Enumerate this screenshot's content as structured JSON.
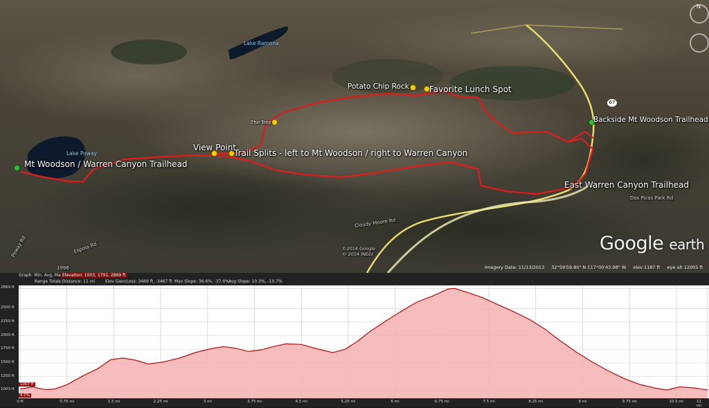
{
  "map": {
    "labels": {
      "trailhead_main": "Mt Woodson / Warren Canyon Trailhead",
      "view_point": "View Point",
      "trail_splits": "Trail Splits - left to Mt Woodson / right to Warren Canyon",
      "potato_chip_rock": "Potato Chip Rock",
      "lunch_spot": "Favorite Lunch Spot",
      "backside_trailhead": "Backside Mt Woodson Trailhead",
      "east_warren": "East Warren Canyon Trailhead",
      "the_tree": "The Tree",
      "lake_poway": "Lake Poway",
      "lake_ramona": "Lake Ramona",
      "highway": "67",
      "road_1": "Espola Rd",
      "road_2": "Dos Picos Park Rd",
      "road_3": "Cloudy Moore Rd",
      "road_4": "Poway Rd",
      "year": "1996"
    },
    "copyright_1": "©2014 Google",
    "copyright_2": "© 2014 INEGI",
    "logo_main": "Google",
    "logo_sub": "earth",
    "compass_letter": "N",
    "status": {
      "imagery_date": "Imagery Date: 11/13/2013",
      "coords": "32°59'59.80\" N  117°00'43.98\" W",
      "elev": "elev  1187 ft",
      "eye_alt": "eye alt  12005 ft"
    }
  },
  "graph": {
    "header_graph": "Graph:  Min, Avg, Max:",
    "header_elevation": "Elevation: 1003, 1791, 2869 ft",
    "header_range": "Range Totals:",
    "header_distance": "Distance: 11 mi",
    "header_gain": "Elev Gain/Loss: 3469 ft, -3467 ft",
    "header_maxslope": "Max Slope: 36.6%, -37.0%",
    "header_avgslope": "Avg Slope: 10.3%, -10.7%",
    "cursor_elev": "1007 ft",
    "cursor_slope": "4.1%"
  },
  "chart_data": {
    "type": "area",
    "title": "",
    "xlabel": "",
    "ylabel": "",
    "ylim": [
      850,
      2925
    ],
    "xlim": [
      0,
      11
    ],
    "y_ticks": [
      "2869 ft",
      "2500 ft",
      "2250 ft",
      "2000 ft",
      "1750 ft",
      "1500 ft",
      "1250 ft",
      "1003 ft"
    ],
    "y_tick_values": [
      2869,
      2500,
      2250,
      2000,
      1750,
      1500,
      1250,
      1003
    ],
    "x_ticks": [
      "0 ft",
      "0.75 mi",
      "1.5 mi",
      "2.25 mi",
      "3 mi",
      "3.75 mi",
      "4.5 mi",
      "5.25 mi",
      "6 mi",
      "6.75 mi",
      "7.5 mi",
      "8.25 mi",
      "9 mi",
      "9.75 mi",
      "10.5 mi",
      "11 mi"
    ],
    "x_tick_values": [
      0,
      0.75,
      1.5,
      2.25,
      3,
      3.75,
      4.5,
      5.25,
      6,
      6.75,
      7.5,
      8.25,
      9,
      9.75,
      10.5,
      11
    ],
    "series": [
      {
        "x": [
          0,
          0.2,
          0.4,
          0.55,
          0.75,
          1.0,
          1.25,
          1.45,
          1.65,
          1.85,
          2.05,
          2.3,
          2.55,
          2.8,
          3.05,
          3.25,
          3.45,
          3.65,
          3.85,
          4.05,
          4.25,
          4.5,
          4.75,
          5.0,
          5.2,
          5.4,
          5.6,
          5.85,
          6.1,
          6.35,
          6.6,
          6.85,
          6.95,
          7.15,
          7.4,
          7.65,
          7.9,
          8.15,
          8.4,
          8.65,
          8.9,
          9.15,
          9.4,
          9.65,
          9.9,
          10.15,
          10.35,
          10.55,
          10.8,
          11
        ],
        "y": [
          1020,
          1060,
          1010,
          1020,
          1100,
          1260,
          1400,
          1560,
          1590,
          1550,
          1480,
          1520,
          1590,
          1690,
          1760,
          1800,
          1770,
          1710,
          1740,
          1800,
          1850,
          1840,
          1760,
          1690,
          1750,
          1900,
          2080,
          2270,
          2450,
          2620,
          2730,
          2860,
          2869,
          2800,
          2700,
          2570,
          2440,
          2300,
          2120,
          1900,
          1700,
          1520,
          1360,
          1220,
          1110,
          1040,
          1003,
          1060,
          1040,
          1003
        ],
        "color": "#b01010"
      }
    ],
    "grid": true,
    "fill_color": "#f6b5b5"
  },
  "colors": {
    "trail": "#e01b1b",
    "highway": "#e8dc6a"
  }
}
